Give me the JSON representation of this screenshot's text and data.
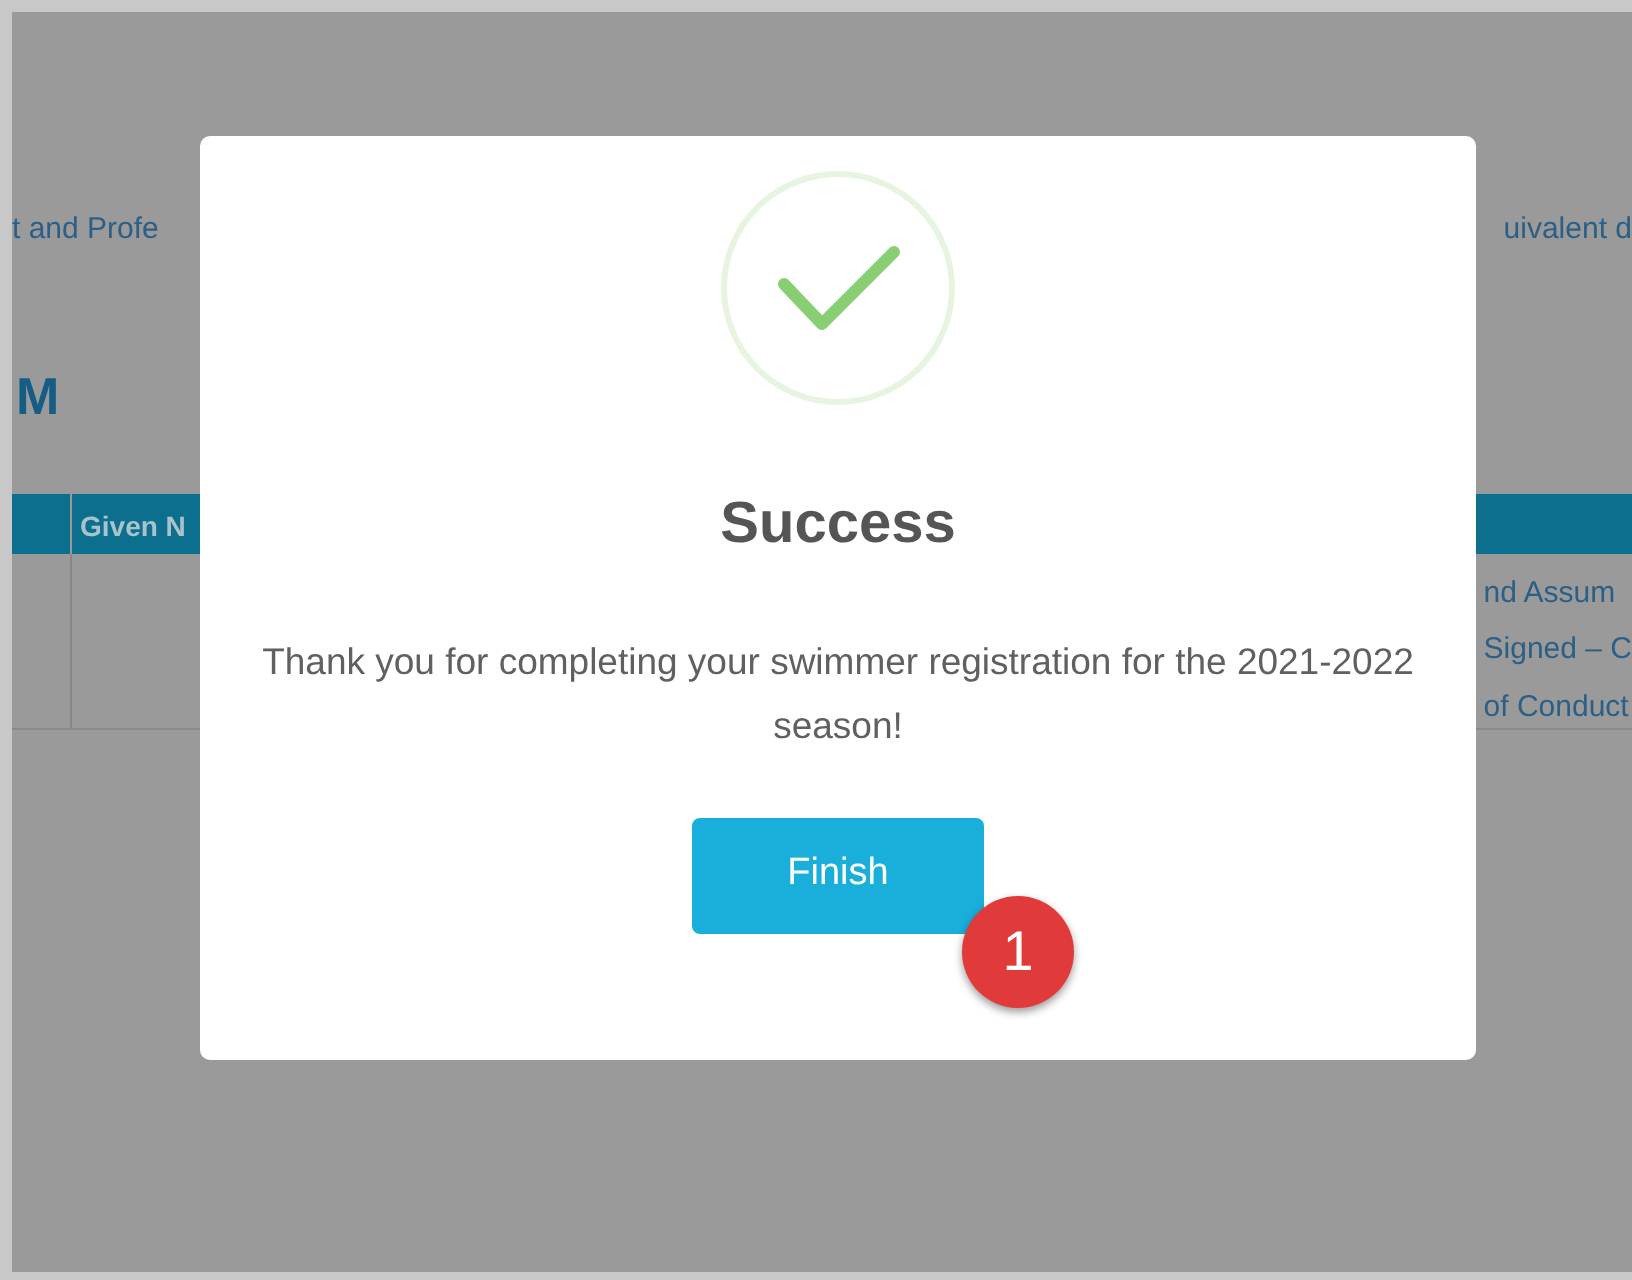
{
  "page": {
    "intro_left": "t and Profe",
    "intro_right": "uivalent d",
    "heading": "M",
    "table": {
      "columns": [
        "Given N"
      ],
      "right_cells": [
        "nd Assum",
        "Signed – C",
        "of Conduct"
      ]
    }
  },
  "modal": {
    "title": "Success",
    "message": "Thank you for completing your swimmer registration for the 2021-2022 season!",
    "button": {
      "label": "Finish"
    },
    "badge": "1"
  }
}
